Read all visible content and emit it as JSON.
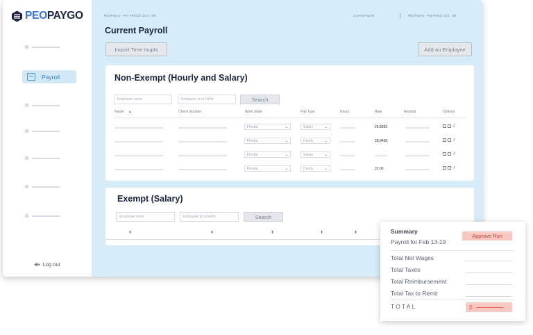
{
  "brand": {
    "logo_part1": "PEO",
    "logo_part2": "PAYGO"
  },
  "sidebar": {
    "active_item": {
      "label": "Payroll",
      "icon": "payroll-icon"
    },
    "logout": {
      "label": "Log out",
      "icon": "logout-icon"
    }
  },
  "header": {
    "crumb_left": "PEOPayGo - PAY PERIOD 2/23 - 3/8",
    "crumb_mid": "Current Payroll",
    "crumb_right": "PEOPayGo - Pay Period 2/23 - 3/8",
    "title": "Current Payroll",
    "import_label": "Import Time Inupts",
    "add_label": "Add an Employee"
  },
  "non_exempt": {
    "title": "Non-Exempt (Hourly and Salary)",
    "name_placeholder": "Employee name",
    "id_placeholder": "Employee id or Refld",
    "search_label": "Search",
    "columns": [
      "Name",
      "Check Number",
      "Work State",
      "Pay Type",
      "Hours",
      "Rate",
      "Amount",
      "Options"
    ],
    "sort_glyph": "▲",
    "rows": [
      {
        "state": "Florida",
        "pay_type": "Salary",
        "rate": "25.8655"
      },
      {
        "state": "Florida",
        "pay_type": "Hourly",
        "rate": "28.8438"
      },
      {
        "state": "Florida",
        "pay_type": "Salary",
        "rate": ""
      },
      {
        "state": "Florida",
        "pay_type": "Hourly",
        "rate": "22.00"
      }
    ],
    "chevron": "⌄",
    "check_glyph": "✓"
  },
  "exempt": {
    "title": "Exempt (Salary)",
    "name_placeholder": "Employee name",
    "id_placeholder": "Employee id or Refld",
    "search_label": "Search",
    "sort_glyph": "⬍"
  },
  "summary": {
    "title": "Summary",
    "subtitle": "Payroll for Feb 13-19",
    "approve_label": "Approve Run",
    "rows": [
      "Total Net Wages",
      "Total Taxes",
      "Total Reimbursement",
      "Total Tax to Remit"
    ],
    "total_label": "TOTAL",
    "currency": "$"
  },
  "colors": {
    "accent": "#3372e0",
    "sidebar_bg": "#ffffff",
    "main_bg": "#d6ecf8",
    "approve_bg": "#f8c8c3",
    "check": "#3bb34a"
  }
}
